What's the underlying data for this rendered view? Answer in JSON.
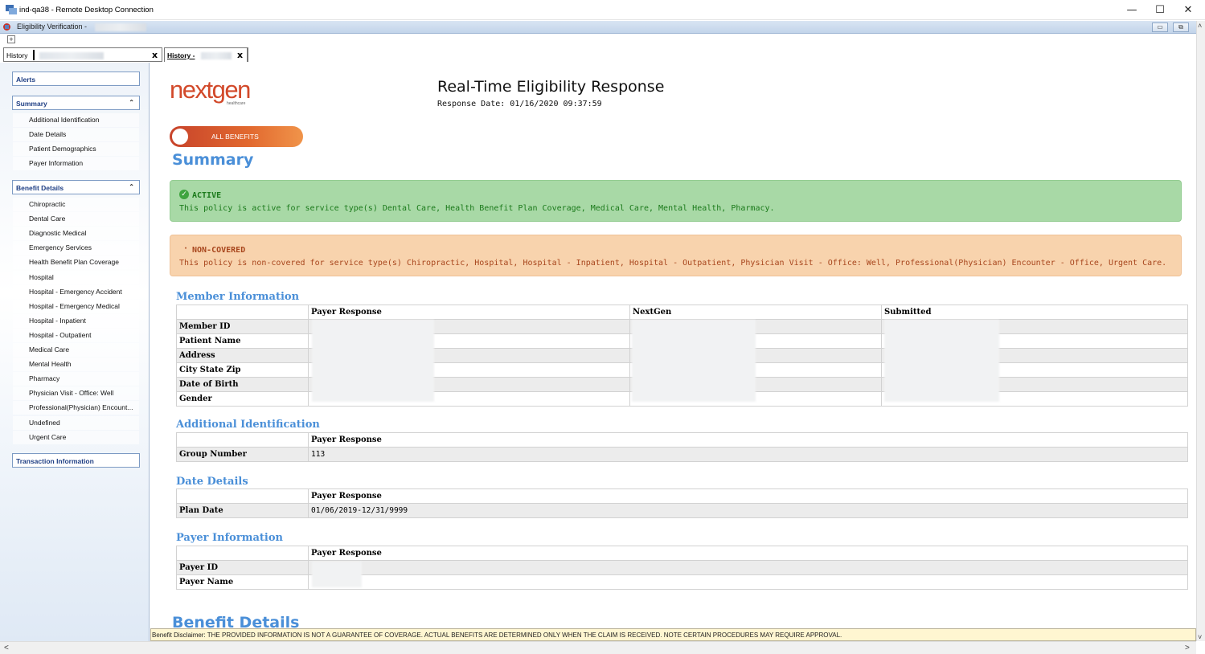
{
  "window": {
    "title": "ind-qa38 - Remote Desktop Connection",
    "minimize": "—",
    "maximize": "☐",
    "close": "✕"
  },
  "app": {
    "title": "Eligibility Verification -",
    "restore_btn": "▭",
    "max_btn": "⧉",
    "plus": "+"
  },
  "tabs": [
    {
      "label": "History",
      "close": "x"
    },
    {
      "label": "History -",
      "close": "x"
    }
  ],
  "nav": {
    "alerts": "Alerts",
    "summary": "Summary",
    "summary_items": [
      "Additional Identification",
      "Date Details",
      "Patient Demographics",
      "Payer Information"
    ],
    "benefit_details": "Benefit Details",
    "benefit_items": [
      "Chiropractic",
      "Dental Care",
      "Diagnostic Medical",
      "Emergency Services",
      "Health Benefit Plan Coverage",
      "Hospital",
      "Hospital - Emergency Accident",
      "Hospital - Emergency Medical",
      "Hospital - Inpatient",
      "Hospital - Outpatient",
      "Medical Care",
      "Mental Health",
      "Pharmacy",
      "Physician Visit - Office: Well",
      "Professional(Physician) Encount...",
      "Undefined",
      "Urgent Care"
    ],
    "transaction": "Transaction Information",
    "collapse_icon": "«"
  },
  "logo": {
    "text": "nextgen",
    "sub": "healthcare"
  },
  "header": {
    "title": "Real-Time Eligibility Response",
    "response_date": "Response Date: 01/16/2020  09:37:59"
  },
  "toggle": {
    "label": "ALL BENEFITS"
  },
  "summary_title": "Summary",
  "active": {
    "heading": "ACTIVE",
    "text": "This policy is active for service type(s) Dental Care, Health Benefit Plan Coverage, Medical Care, Mental Health, Pharmacy.",
    "color": "#1b7a1b"
  },
  "noncovered": {
    "heading": "NON-COVERED",
    "text": "This policy is non-covered for service type(s) Chiropractic, Hospital, Hospital - Inpatient, Hospital - Outpatient, Physician Visit - Office: Well, Professional(Physician) Encounter - Office, Urgent Care.",
    "color": "#a8461d"
  },
  "member_info": {
    "title": "Member Information",
    "columns": [
      "Payer Response",
      "NextGen",
      "Submitted"
    ],
    "rows": [
      "Member ID",
      "Patient Name",
      "Address",
      "City State Zip",
      "Date of Birth",
      "Gender"
    ]
  },
  "additional_id": {
    "title": "Additional Identification",
    "column": "Payer Response",
    "row_label": "Group Number",
    "row_value": "113"
  },
  "date_details": {
    "title": "Date Details",
    "column": "Payer Response",
    "row_label": "Plan Date",
    "row_value": "01/06/2019-12/31/9999"
  },
  "payer_info": {
    "title": "Payer Information",
    "column": "Payer Response",
    "rows": [
      "Payer ID",
      "Payer Name"
    ]
  },
  "benefit_title": "Benefit Details",
  "disclaimer": "Benefit Disclaimer: THE PROVIDED INFORMATION IS NOT A GUARANTEE OF COVERAGE.  ACTUAL BENEFITS ARE DETERMINED ONLY WHEN THE CLAIM IS RECEIVED. NOTE CERTAIN PROCEDURES MAY REQUIRE APPROVAL.",
  "scroll": {
    "up": "˄",
    "down": "˅",
    "left": "<",
    "right": ">"
  }
}
